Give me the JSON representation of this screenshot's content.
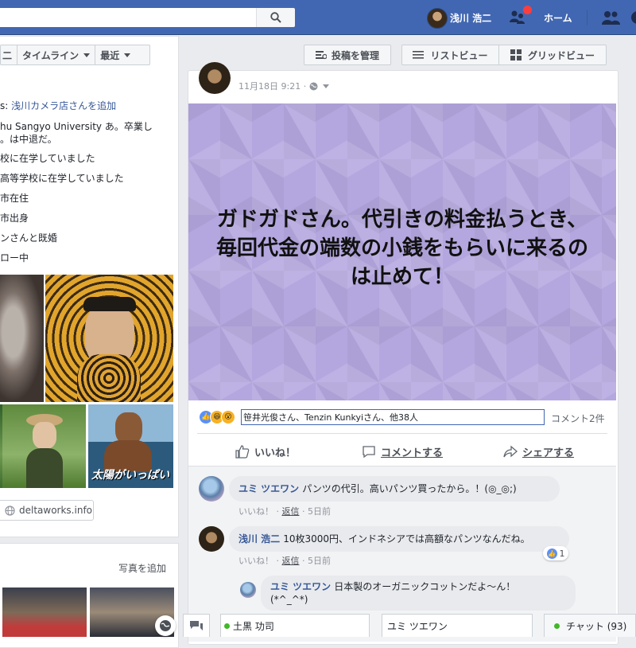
{
  "header": {
    "user_name": "浅川 浩二",
    "home_label": "ホーム"
  },
  "timeline_tabs": {
    "partial_label": "二",
    "timeline_label": "タイムライン",
    "recent_label": "最近"
  },
  "intro": [
    {
      "prefix": "s: ",
      "text": "浅川カメラ店さんを追加"
    },
    {
      "prefix": "",
      "text": "hu Sangyo University あ。卒業し"
    },
    {
      "prefix": "",
      "text": "。は中退だ。"
    },
    {
      "prefix": "",
      "text": "校に在学していました"
    },
    {
      "prefix": "",
      "text": "高等学校に在学していました"
    },
    {
      "prefix": "",
      "text": "市在住"
    },
    {
      "prefix": "",
      "text": "市出身"
    },
    {
      "prefix": "",
      "text": "ンさんと既婚"
    },
    {
      "prefix": "",
      "text": "ロー中"
    }
  ],
  "photo_overlay_text": "太陽がいっぱい",
  "website": "deltaworks.info",
  "photos_card": {
    "add_photo": "写真を追加"
  },
  "toolbar": {
    "manage_posts": "投稿を管理",
    "list_view": "リストビュー",
    "grid_view": "グリッドビュー"
  },
  "post": {
    "timestamp": "11月18日 9:21 ·",
    "banner_text": "ガドガドさん。代引きの料金払うとき、毎回代金の端数の小銭をもらいに来るのは止めて！",
    "likers": "笹井光俊さん、Tenzin Kunkyiさん、他38人",
    "comment_count": "コメント2件",
    "actions": {
      "like": "いいね！",
      "comment": "コメントする",
      "share": "シェアする"
    }
  },
  "comments": [
    {
      "name": "ユミ ツエワン",
      "text": "パンツの代引。高いパンツ買ったから。！(◎_◎;)",
      "like": "いいね！",
      "reply": "返信",
      "time": "5日前"
    },
    {
      "name": "浅川 浩二",
      "text": "10枚3000円、インドネシアでは高額なパンツなんだね。",
      "like": "いいね！",
      "reply": "返信",
      "time": "5日前",
      "like_count": "1"
    },
    {
      "name": "ユミ ツエワン",
      "text": "日本製のオーガニックコットンだよ～ん！",
      "text2": "(*^_^*)"
    }
  ],
  "chat": {
    "tab1": "土黒 功司",
    "tab2": "ユミ ツエワン",
    "chat_label": "チャット (93)"
  },
  "colors": {
    "brand_blue": "#4267b2",
    "link_blue": "#385898",
    "banner_purple": "#b4a7df",
    "online_green": "#42b72a",
    "notification_red": "#fa3e3e"
  }
}
